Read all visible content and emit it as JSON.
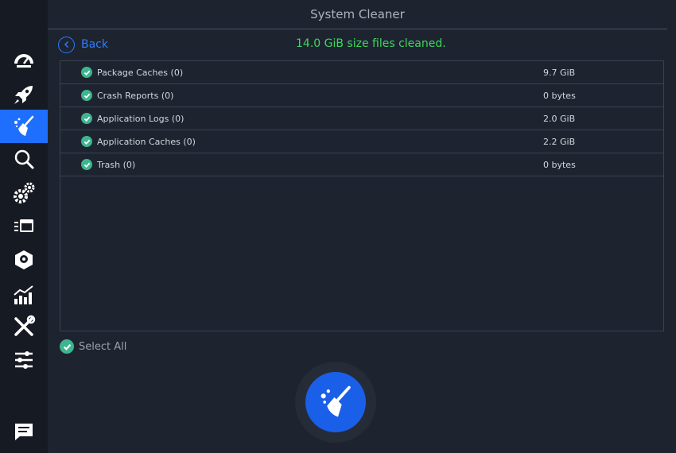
{
  "window": {
    "title": "System Cleaner"
  },
  "sidebar": {
    "items": [
      {
        "icon": "dashboard-gauge-icon",
        "active": false
      },
      {
        "icon": "rocket-icon",
        "active": false
      },
      {
        "icon": "broom-icon",
        "active": true
      },
      {
        "icon": "search-icon",
        "active": false
      },
      {
        "icon": "gears-icon",
        "active": false
      },
      {
        "icon": "window-stack-icon",
        "active": false
      },
      {
        "icon": "disk-icon",
        "active": false
      },
      {
        "icon": "chart-icon",
        "active": false
      },
      {
        "icon": "tools-icon",
        "active": false
      },
      {
        "icon": "sliders-icon",
        "active": false
      },
      {
        "icon": "chat-icon",
        "active": false
      }
    ],
    "accent": "#1f6fff"
  },
  "toolbar": {
    "back_label": "Back",
    "status": "14.0 GiB size files cleaned."
  },
  "items": [
    {
      "label": "Package Caches (0)",
      "size": "9.7 GiB",
      "checked": true
    },
    {
      "label": "Crash Reports (0)",
      "size": "0 bytes",
      "checked": true
    },
    {
      "label": "Application Logs (0)",
      "size": "2.0 GiB",
      "checked": true
    },
    {
      "label": "Application Caches (0)",
      "size": "2.2 GiB",
      "checked": true
    },
    {
      "label": "Trash (0)",
      "size": "0 bytes",
      "checked": true
    }
  ],
  "select_all": {
    "label": "Select All",
    "checked": true
  },
  "colors": {
    "success": "#3ed65c",
    "check": "#3fb58f",
    "link": "#2d7bff"
  }
}
